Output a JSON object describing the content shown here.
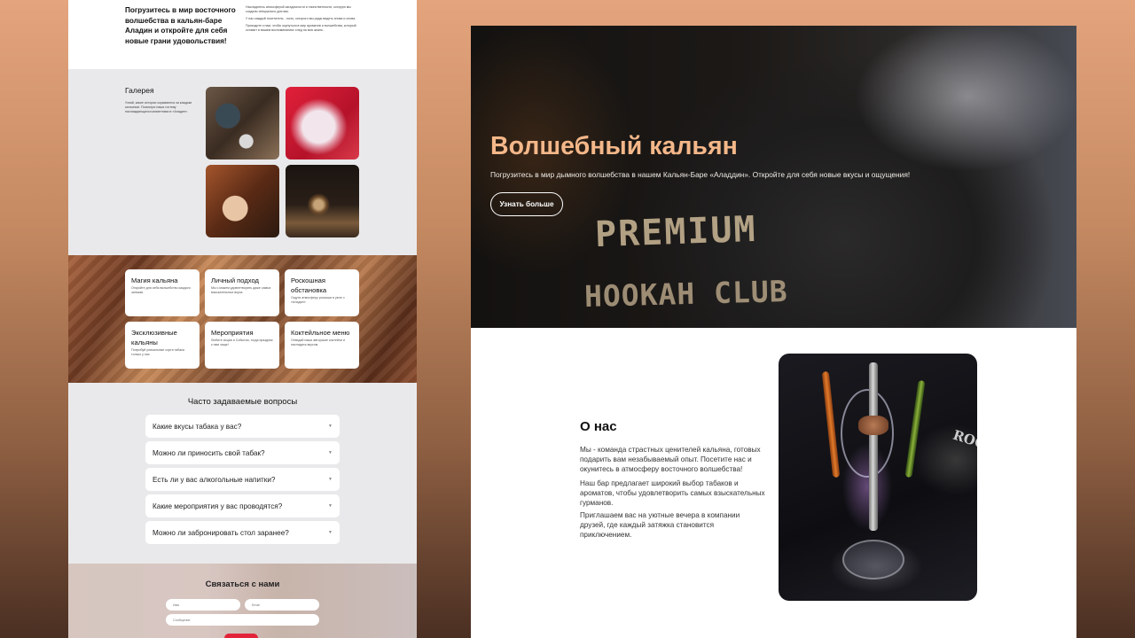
{
  "left_page": {
    "intro": {
      "headline": "Погрузитесь в мир восточного волшебства в кальян-баре Аладин и откройте для себя новые грани удовольствия!",
      "paragraphs": [
        "Насладитесь атмосферой загадочности и таинственности, которую мы создали специально для вас.",
        "У нас каждый посетитель - гость, которого мы рады видеть снова и снова.",
        "Приходите к нам, чтобы окунуться в мир ароматов и волшебства, который оставит в вашем воспоминаниях след на всю жизнь."
      ]
    },
    "gallery": {
      "title": "Галерея",
      "description": "Узнай, какие истории скрываются за каждым кальяном. Посмотри наши гостеву наслаждающихся моментами в «Аладин»."
    },
    "features": [
      {
        "title": "Магия кальяна",
        "text": "Откройте для себя волшебство каждого затяжки."
      },
      {
        "title": "Личный подход",
        "text": "Мы с можем удовлетворить даже самых взыскательных вкуса."
      },
      {
        "title": "Роскошная обстановка",
        "text": "Ощути атмосферу роскоши в уюте с «Аладин»."
      },
      {
        "title": "Эксклюзивные кальяны",
        "text": "Попробуй уникальные сорта табака только у нас."
      },
      {
        "title": "Мероприятия",
        "text": "Любите Акции и События, тогда праздник к нам чаще!"
      },
      {
        "title": "Коктейльное меню",
        "text": "Отведай наши авторские коктейли и насладись вкусом."
      }
    ],
    "faq": {
      "title": "Часто задаваемые вопросы",
      "items": [
        "Какие вкусы табака у вас?",
        "Можно ли приносить свой табак?",
        "Есть ли у вас алкогольные напитки?",
        "Какие мероприятия у вас проводятся?",
        "Можно ли забронировать стол заранее?"
      ]
    },
    "contact": {
      "title": "Связаться с нами",
      "name_placeholder": "Имя",
      "email_placeholder": "Email",
      "message_placeholder": "Сообщение"
    }
  },
  "right_page": {
    "hero": {
      "title": "Волшебный кальян",
      "subtitle": "Погрузитесь в мир дымного волшебства в нашем Кальян-Баре «Аладдин». Откройте для себя новые вкусы и ощущения!",
      "button_label": "Узнать больше",
      "photo_text_line1": "PREMIUM",
      "photo_text_line2": "HOOKAH CLUB"
    },
    "about": {
      "title": "О нас",
      "paragraphs": [
        "Мы - команда страстных ценителей кальяна, готовых подарить вам незабываемый опыт. Посетите нас и окунитесь в атмосферу восточного волшебства!",
        "Наш бар предлагает широкий выбор табаков и ароматов, чтобы удовлетворить самых взыскательных гурманов.",
        "Приглашаем вас на уютные вечера в компании друзей, где каждый затяжка становится приключением."
      ],
      "photo_text": "ROCK"
    }
  },
  "colors": {
    "background_top": "#e4a47d",
    "background_bottom": "#4a2f22",
    "hero_title": "#f4b789",
    "accent_red": "#e3233a",
    "section_gray": "#e9e9eb"
  }
}
